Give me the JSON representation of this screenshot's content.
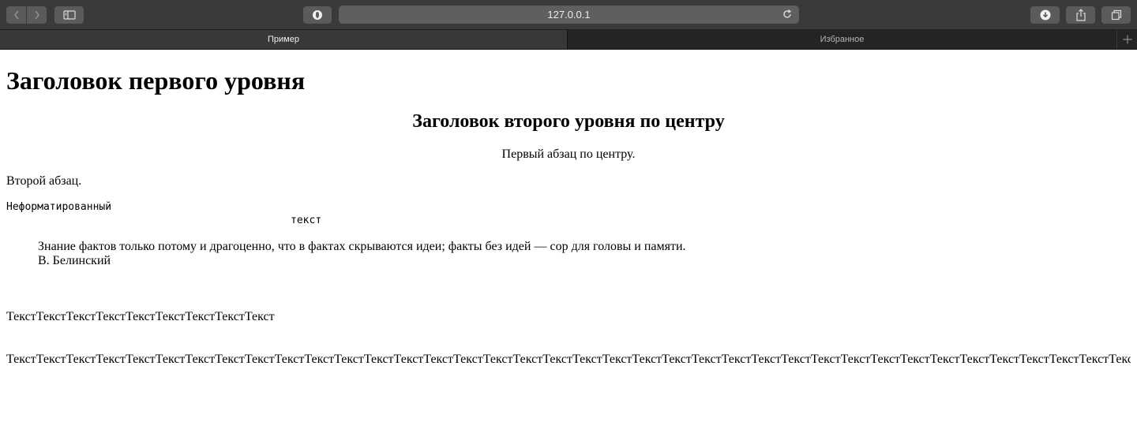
{
  "browser": {
    "url": "127.0.0.1",
    "tabs": [
      {
        "label": "Пример",
        "active": true
      },
      {
        "label": "Избранное",
        "active": false
      }
    ]
  },
  "page": {
    "h1": "Заголовок первого уровня",
    "h2": "Заголовок второго уровня по центру",
    "p_center": "Первый абзац по центру.",
    "p_second": "Второй абзац.",
    "pre_text": "Неформатированный\n                                              текст",
    "quote_text": "Знание фактов только потому и драгоценно, что в фактах скрываются идеи; факты без идей — сор для головы и памяти.",
    "quote_author": "В. Белинский",
    "text_line1": "ТекстТекстТекстТекстТекстТекстТекстТекстТекст",
    "text_line2": "ТекстТекстТекстТекстТекстТекстТекстТекстТекстТекстТекстТекстТекстТекстТекстТекстТекстТекстТекстТекстТекстТекстТекстТекстТекстТекстТекстТекстТекстТекстТекстТекстТекстТекстТекстТекстТекстТекст"
  }
}
